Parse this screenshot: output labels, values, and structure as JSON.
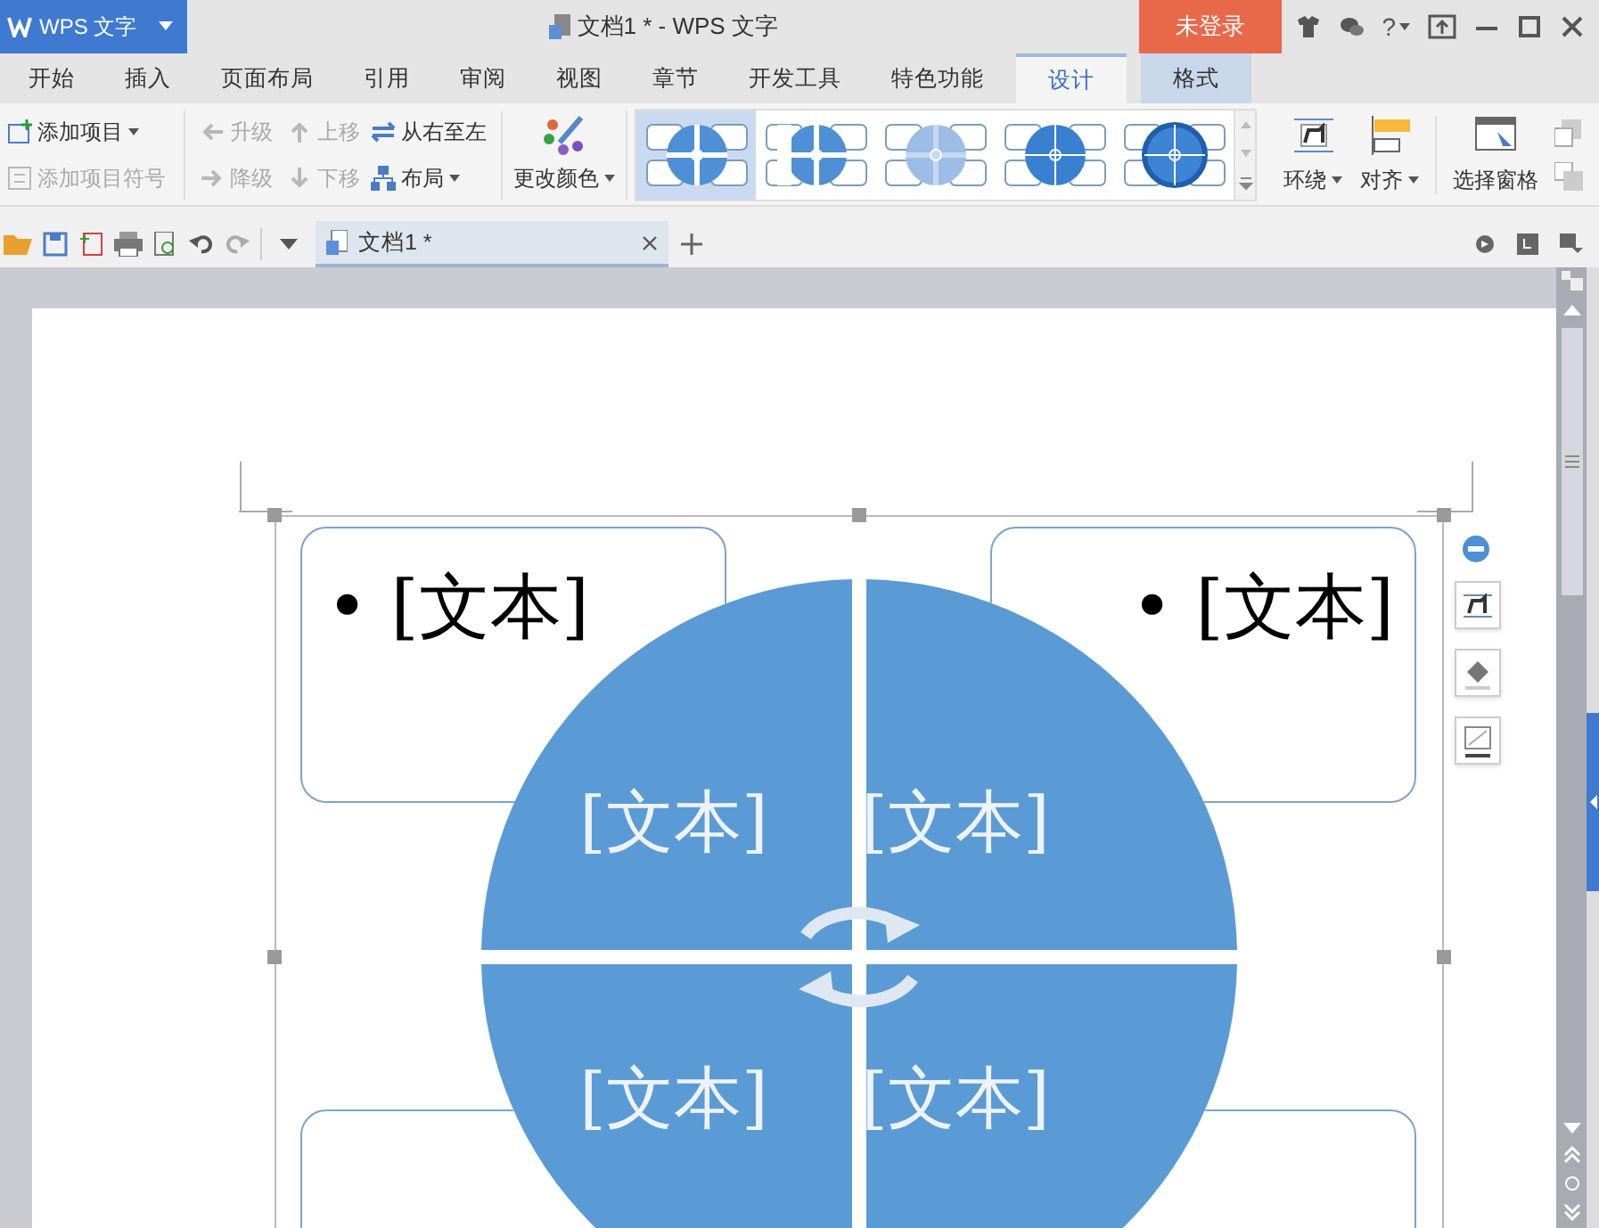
{
  "app_menu": {
    "label": "WPS 文字"
  },
  "window": {
    "title": "文档1 * - WPS 文字"
  },
  "login_button": {
    "label": "未登录"
  },
  "help_button": {
    "label": "?"
  },
  "tabs": [
    {
      "label": "开始",
      "selected": false,
      "contextual": false
    },
    {
      "label": "插入",
      "selected": false,
      "contextual": false
    },
    {
      "label": "页面布局",
      "selected": false,
      "contextual": false
    },
    {
      "label": "引用",
      "selected": false,
      "contextual": false
    },
    {
      "label": "审阅",
      "selected": false,
      "contextual": false
    },
    {
      "label": "视图",
      "selected": false,
      "contextual": false
    },
    {
      "label": "章节",
      "selected": false,
      "contextual": false
    },
    {
      "label": "开发工具",
      "selected": false,
      "contextual": false
    },
    {
      "label": "特色功能",
      "selected": false,
      "contextual": false
    },
    {
      "label": "设计",
      "selected": true,
      "contextual": true
    },
    {
      "label": "格式",
      "selected": false,
      "contextual": true
    }
  ],
  "ribbon": {
    "add_item": {
      "label": "添加项目",
      "disabled": false
    },
    "add_bullet": {
      "label": "添加项目符号",
      "disabled": true
    },
    "promote": {
      "label": "升级",
      "disabled": true
    },
    "move_up": {
      "label": "上移",
      "disabled": true
    },
    "right_to_left": {
      "label": "从右至左",
      "disabled": false
    },
    "demote": {
      "label": "降级",
      "disabled": true
    },
    "move_down": {
      "label": "下移",
      "disabled": true
    },
    "layout": {
      "label": "布局",
      "disabled": false
    },
    "change_colors": {
      "label": "更改颜色"
    },
    "styles": [
      {
        "kind": "flat",
        "selected": true
      },
      {
        "kind": "cut",
        "selected": false
      },
      {
        "kind": "light",
        "selected": false
      },
      {
        "kind": "deep",
        "selected": false
      },
      {
        "kind": "shadow",
        "selected": false
      }
    ],
    "wrap": {
      "label": "环绕"
    },
    "align": {
      "label": "对齐"
    },
    "selection_pane": {
      "label": "选择窗格"
    }
  },
  "doc_tab": {
    "label": "文档1 *",
    "selected": true
  },
  "smartart": {
    "side_boxes": [
      {
        "text": "• [文本]"
      },
      {
        "text": "• [文本]"
      }
    ],
    "quadrants": [
      "[文本]",
      "[文本]",
      "[文本]",
      "[文本]"
    ]
  }
}
